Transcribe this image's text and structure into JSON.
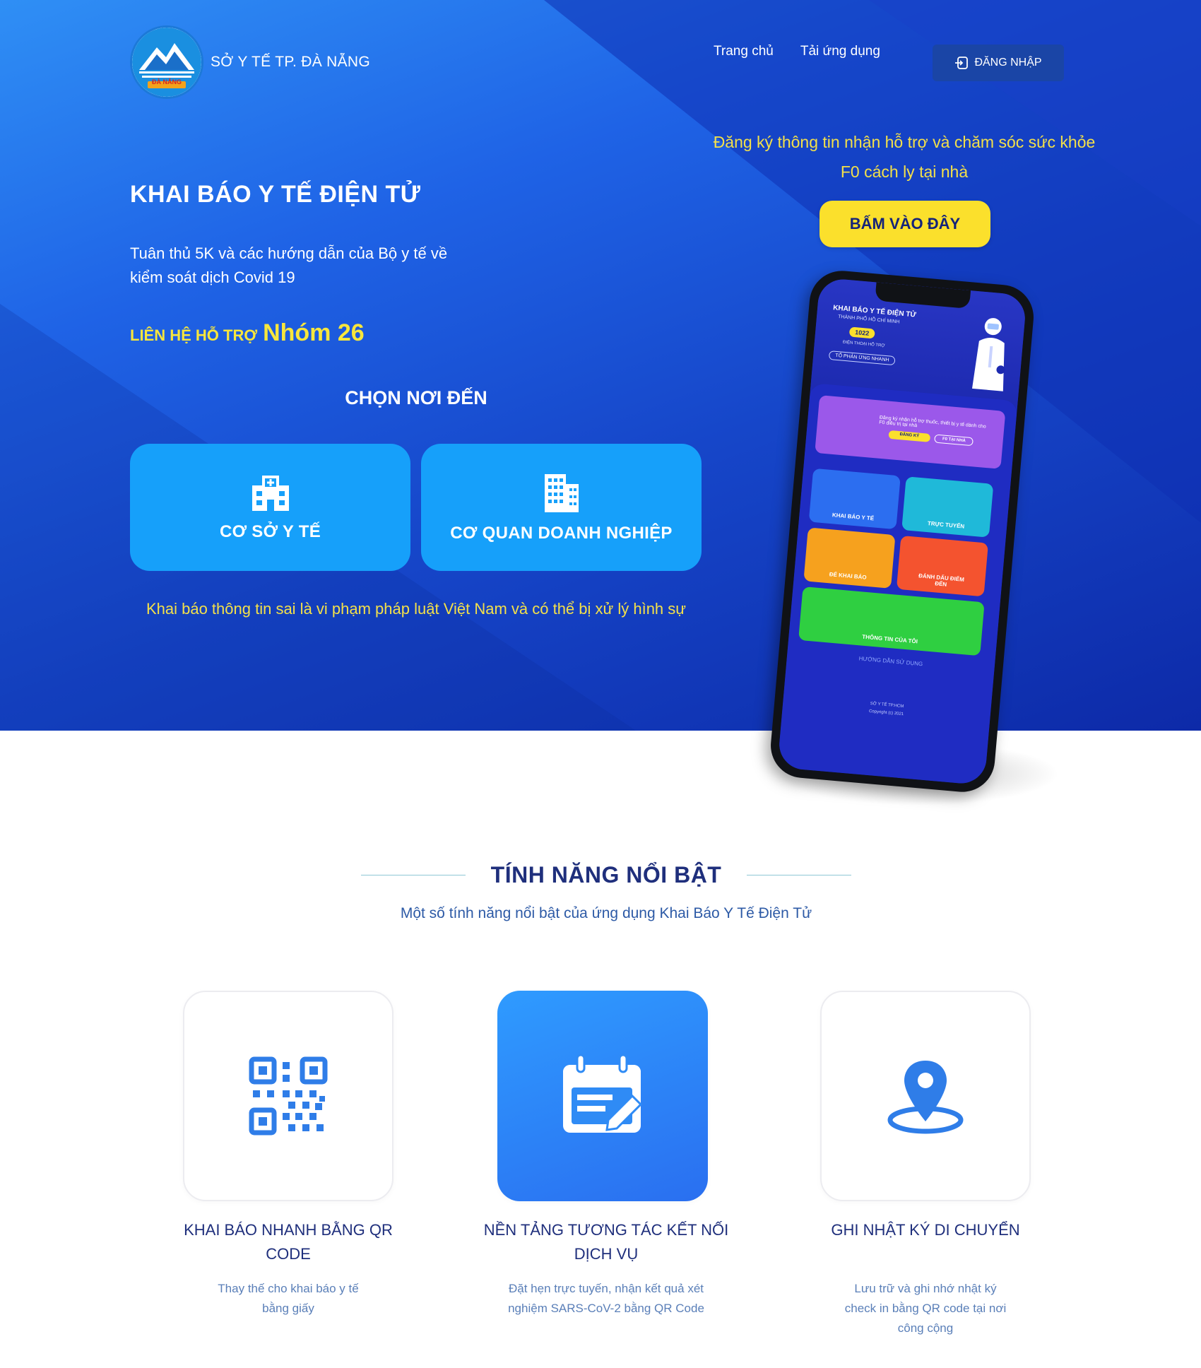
{
  "header": {
    "logo_text": "SỞ Y TẾ TP. ĐÀ NẴNG",
    "logo_badge": "ĐÀ NẴNG",
    "nav": [
      {
        "label": "Trang chủ"
      },
      {
        "label": "Tải ứng dụng"
      }
    ],
    "login_label": "ĐĂNG NHẬP"
  },
  "hero": {
    "title": "KHAI BÁO Y TẾ ĐIỆN TỬ",
    "description": "Tuân thủ 5K và các hướng dẫn của Bộ y tế về kiểm soát dịch Covid 19",
    "support_label": "LIÊN HỆ HỖ TRỢ",
    "support_value": "Nhóm 26",
    "choose_title": "CHỌN NƠI ĐẾN",
    "options": [
      {
        "label": "CƠ SỞ Y TẾ",
        "icon": "hospital-icon"
      },
      {
        "label": "CƠ QUAN DOANH NGHIỆP",
        "icon": "building-icon"
      }
    ],
    "warning": "Khai báo thông tin sai là vi phạm pháp luật Việt Nam và có thể bị xử lý hình sự"
  },
  "promo": {
    "text": "Đăng ký thông tin nhận hỗ trợ và chăm sóc sức khỏe F0 cách ly tại nhà",
    "cta_label": "BẤM VÀO ĐÂY"
  },
  "phone": {
    "title": "KHAI BÁO Y TẾ ĐIỆN TỬ",
    "subtitle": "THÀNH PHỐ HỒ CHÍ MINH",
    "hotline": "1022",
    "hotline_caption": "ĐIỆN THOẠI HỖ TRỢ",
    "rapid": "TỔ PHẢN ỨNG NHANH",
    "tile_register_text": "Đăng ký nhận hỗ trợ thuốc, thiết bị y tế dành cho F0 điều trị tại nhà",
    "tile_register_btn": "ĐĂNG KÝ",
    "tile_register_btn2": "F0 TẠI NHÀ",
    "tile_declare": "KHAI BÁO Y TẾ",
    "tile_schedule": "TRỰC TUYẾN",
    "tile_qr_declare": "ĐỂ KHAI BÁO",
    "tile_qr_mark": "ĐÁNH DẤU ĐIỂM ĐẾN",
    "tile_my_info": "THÔNG TIN CỦA TÔI",
    "guide": "HƯỚNG DẪN SỬ DỤNG",
    "footer_org": "SỞ Y TẾ TP.HCM",
    "footer_copy": "Copyright (c) 2021"
  },
  "features": {
    "title": "TÍNH NĂNG NỔI BẬT",
    "subtitle": "Một số tính năng nổi bật của ứng dụng Khai Báo Y Tế Điện Tử",
    "items": [
      {
        "name": "KHAI BÁO NHANH BẰNG QR CODE",
        "desc": "Thay thế cho khai báo y tế bằng giấy",
        "icon": "qr-code-icon"
      },
      {
        "name": "NỀN TẢNG TƯƠNG TÁC KẾT NỐI DỊCH VỤ",
        "desc": "Đặt hẹn trực tuyến, nhận kết quả xét nghiệm SARS-CoV-2 bằng QR Code",
        "icon": "calendar-edit-icon"
      },
      {
        "name": "GHI NHẬT KÝ DI CHUYỂN",
        "desc": "Lưu trữ và ghi nhớ nhật ký check in bằng QR code tại nơi công cộng",
        "icon": "location-pin-icon"
      }
    ]
  },
  "colors": {
    "hero_blue": "#1f63e6",
    "accent_yellow": "#fbe02c",
    "card_blue": "#16a0fa",
    "title_navy": "#1f2f7c"
  }
}
